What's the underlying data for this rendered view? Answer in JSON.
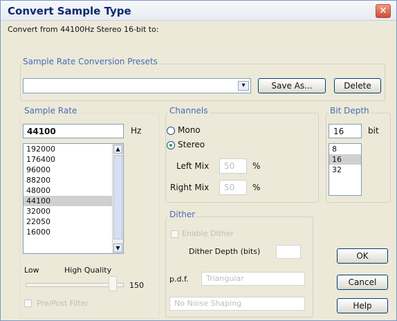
{
  "dialog": {
    "title": "Convert Sample Type",
    "close_glyph": "×",
    "convert_from": "Convert from 44100Hz Stereo 16-bit to:"
  },
  "presets": {
    "label": "Sample Rate Conversion Presets",
    "value": "",
    "dropdown_glyph": "▾",
    "save_as": "Save As...",
    "delete": "Delete"
  },
  "sample_rate": {
    "label": "Sample Rate",
    "value": "44100",
    "unit": "Hz",
    "options": [
      "192000",
      "176400",
      "96000",
      "88200",
      "48000",
      "44100",
      "32000",
      "22050",
      "16000"
    ],
    "selected": "44100",
    "quality_low": "Low",
    "quality_high": "High Quality",
    "quality_value": "150",
    "pre_post_filter": "Pre/Post Filter"
  },
  "channels": {
    "label": "Channels",
    "mono": "Mono",
    "stereo": "Stereo",
    "selected": "Stereo",
    "left_mix": "Left Mix",
    "right_mix": "Right Mix",
    "left_value": "50",
    "right_value": "50",
    "percent": "%"
  },
  "dither": {
    "label": "Dither",
    "enable": "Enable Dither",
    "depth_label": "Dither Depth (bits)",
    "pdf_label": "p.d.f.",
    "pdf_value": "Triangular",
    "noise_shaping": "No Noise Shaping"
  },
  "bit_depth": {
    "label": "Bit Depth",
    "value": "16",
    "unit": "bit",
    "options": [
      "8",
      "16",
      "32"
    ],
    "selected": "16"
  },
  "buttons": {
    "ok": "OK",
    "cancel": "Cancel",
    "help": "Help"
  }
}
